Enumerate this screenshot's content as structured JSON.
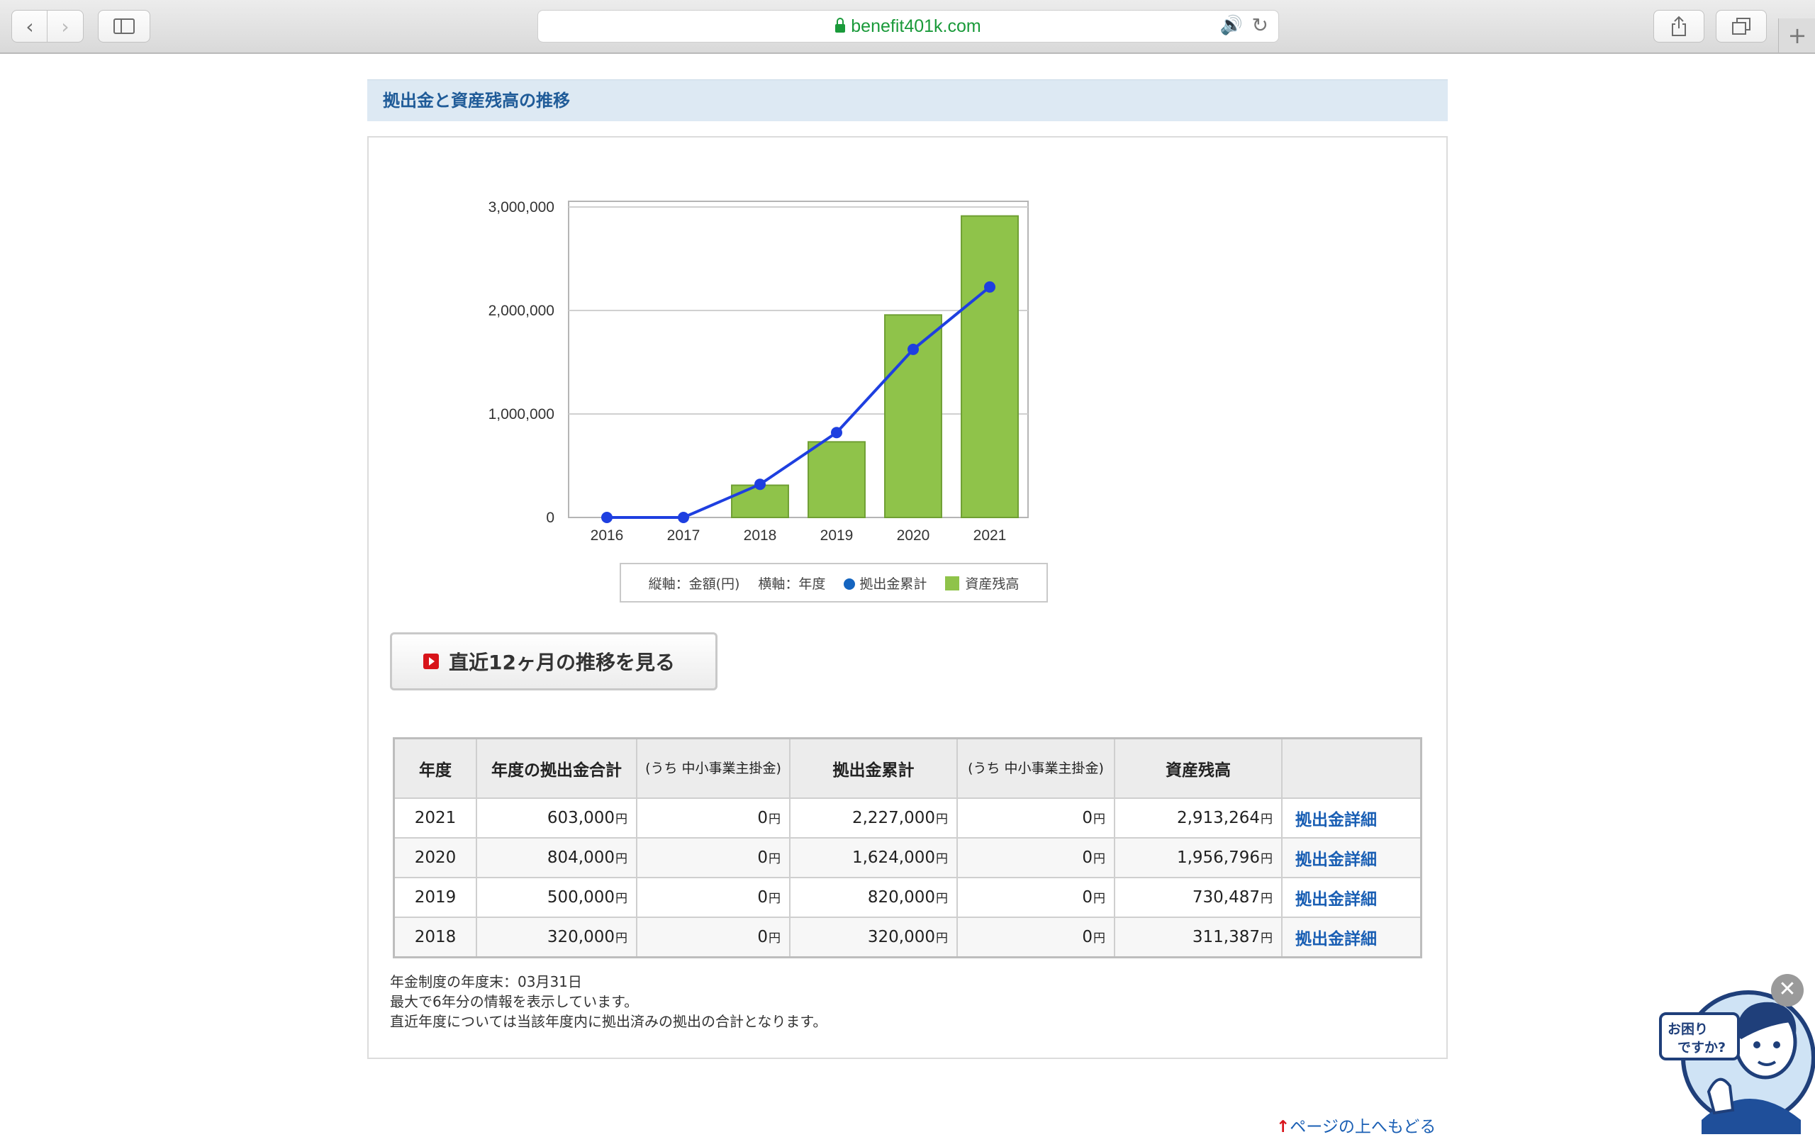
{
  "browser": {
    "url": "benefit401k.com"
  },
  "section": {
    "title": "拠出金と資産残高の推移"
  },
  "chart_data": {
    "type": "bar",
    "categories": [
      "2016",
      "2017",
      "2018",
      "2019",
      "2020",
      "2021"
    ],
    "series": [
      {
        "name": "資産残高",
        "type": "bar",
        "color": "#8fc34a",
        "values": [
          0,
          0,
          311387,
          730487,
          1956796,
          2913264
        ]
      },
      {
        "name": "拠出金累計",
        "type": "line",
        "color": "#1e3fe0",
        "values": [
          0,
          0,
          320000,
          820000,
          1624000,
          2227000
        ]
      }
    ],
    "yticks": [
      "3,000,000",
      "2,000,000",
      "1,000,000",
      "0"
    ],
    "ylim": [
      0,
      3000000
    ],
    "legend": {
      "vertical": "縦軸：金額(円)",
      "horizontal": "横軸：年度",
      "line": "拠出金累計",
      "bar": "資産残高"
    }
  },
  "recent_button": "直近12ヶ月の推移を見る",
  "table": {
    "headers": [
      "年度",
      "年度の拠出金合計",
      "(うち 中小事業主掛金)",
      "拠出金累計",
      "(うち 中小事業主掛金)",
      "資産残高"
    ],
    "yen": "円",
    "rows": [
      {
        "year": "2021",
        "contrib": "603,000",
        "sme1": "0",
        "cumulative": "2,227,000",
        "sme2": "0",
        "balance": "2,913,264",
        "link": "拠出金詳細"
      },
      {
        "year": "2020",
        "contrib": "804,000",
        "sme1": "0",
        "cumulative": "1,624,000",
        "sme2": "0",
        "balance": "1,956,796",
        "link": "拠出金詳細"
      },
      {
        "year": "2019",
        "contrib": "500,000",
        "sme1": "0",
        "cumulative": "820,000",
        "sme2": "0",
        "balance": "730,487",
        "link": "拠出金詳細"
      },
      {
        "year": "2018",
        "contrib": "320,000",
        "sme1": "0",
        "cumulative": "320,000",
        "sme2": "0",
        "balance": "311,387",
        "link": "拠出金詳細"
      }
    ]
  },
  "notes": [
    "年金制度の年度末：03月31日",
    "最大で6年分の情報を表示しています。",
    "直近年度については当該年度内に拠出済みの拠出の合計となります。"
  ],
  "back_to_top": "ページの上へもどる",
  "help_widget": {
    "text": "お困りですか?"
  }
}
